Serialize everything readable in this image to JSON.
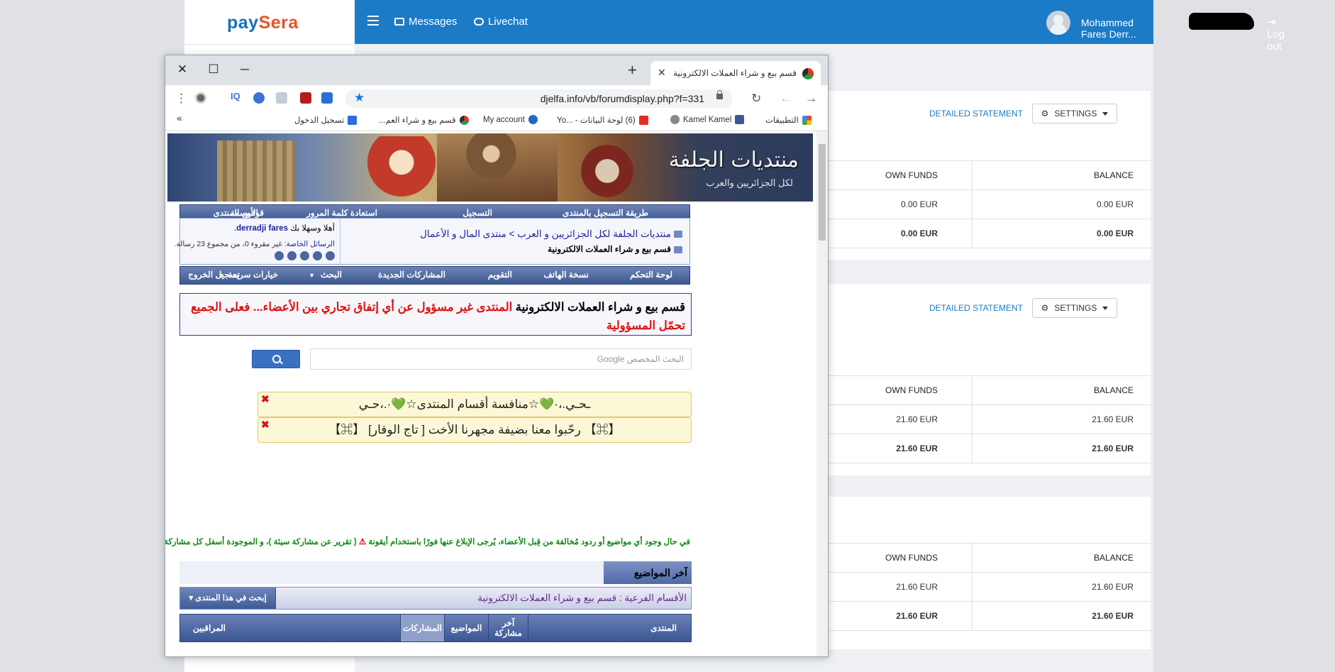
{
  "paysera": {
    "logo_main": "pay",
    "logo_accent": "Sera",
    "nav": {
      "messages": "Messages",
      "livechat": "Livechat",
      "logout": "Log out"
    },
    "user_name": "Mohammed Fares Derr...",
    "cards": [
      {
        "detailed_statement": "DETAILED STATEMENT",
        "settings": "SETTINGS",
        "headers": {
          "own_funds": "OWN FUNDS",
          "balance": "BALANCE"
        },
        "rows": [
          {
            "own_funds": "0.00 EUR",
            "balance": "0.00 EUR"
          },
          {
            "own_funds": "0.00 EUR",
            "balance": "0.00 EUR"
          }
        ]
      },
      {
        "detailed_statement": "DETAILED STATEMENT",
        "settings": "SETTINGS",
        "headers": {
          "own_funds": "OWN FUNDS",
          "balance": "BALANCE"
        },
        "rows": [
          {
            "own_funds": "21.60 EUR",
            "balance": "21.60 EUR"
          },
          {
            "own_funds": "21.60 EUR",
            "balance": "21.60 EUR"
          }
        ]
      },
      {
        "headers": {
          "own_funds": "OWN FUNDS",
          "balance": "BALANCE"
        },
        "rows": [
          {
            "own_funds": "21.60 EUR",
            "balance": "21.60 EUR"
          },
          {
            "own_funds": "21.60 EUR",
            "balance": "21.60 EUR"
          }
        ]
      }
    ]
  },
  "browser": {
    "tab_title": "قسم بيع و شراء العملات الالكترونية",
    "url": "djelfa.info/vb/forumdisplay.php?f=331",
    "bookmarks": {
      "apps": "التطبيقات",
      "kamel": "Kamel Kamel",
      "youtube": "(6) لوحة البيانات - ...Yo",
      "my_account": "My account",
      "forum": "قسم بيع و شراء العم...",
      "login": "تسجيل الدخول",
      "more": "»"
    }
  },
  "forum": {
    "banner_logo": "منتديات الجلفة",
    "banner_sub": "لكل الجزائريين والعرب",
    "topnav": [
      "طريقة التسجيل بالمنتدى",
      "التسجيل",
      "استعادة كلمة المرور",
      "الأوسمة",
      "قوانين المنتدى"
    ],
    "breadcrumb_main": "منتديات الجلفة لكل الجزائريين و العرب > منتدى المال و الأعمال",
    "breadcrumb_current": "قسم بيع و شراء العملات الالكترونية",
    "welcome_prefix": "أهلا وسهلا بك",
    "welcome_user": "derradji fares",
    "pm_label": "الرسائل الخاصة:",
    "pm_text": "غير مقروء 0، من مجموع 23 رسالة.",
    "subnav": [
      "لوحة التحكم",
      "نسخة الهاتف",
      "التقويم",
      "المشاركات الجديدة",
      "البحث",
      "خيارات سريعة",
      "تسجيل الخروج"
    ],
    "notice_black": "قسم بيع و شراء العملات الالكترونية",
    "notice_red": "المنتدى غير مسؤول عن أي إتفاق تجاري بين الأعضاء... فعلى الجميع تحمّل المسؤولية",
    "search_placeholder": "البحث المخصص Google",
    "announcement1": "ـحـي.،·💚☆منافسة أقسام المنتدى☆💚·.،حـي",
    "announcement2": "【⌘】 رحّبوا معنا بضيفة مجهرنا الأخت [ تاج الوقار] 【⌘】",
    "close_x": "✖",
    "report_notice_1": "في حال وجود أي مواضيع أو ردود مُخالفة من قِبل الأعضاء، يُرجى الإبلاغ عنها فورًا باستخدام أيقونة",
    "report_icon": "⚠",
    "report_notice_2": "( تقرير عن مشاركة سيئة )، و الموجودة أسفل كل مشاركة .",
    "latest_topics": "آخر المواضيع",
    "subforum_label": "الأقسام الفرعية : قسم بيع و شراء العملات الالكترونية",
    "search_forum_btn": "إبحث في هذا المنتدى ▾",
    "table_headers": [
      "المنتدى",
      "آخر مشاركة",
      "المواضيع",
      "المشاركات",
      "المراقبين"
    ]
  }
}
